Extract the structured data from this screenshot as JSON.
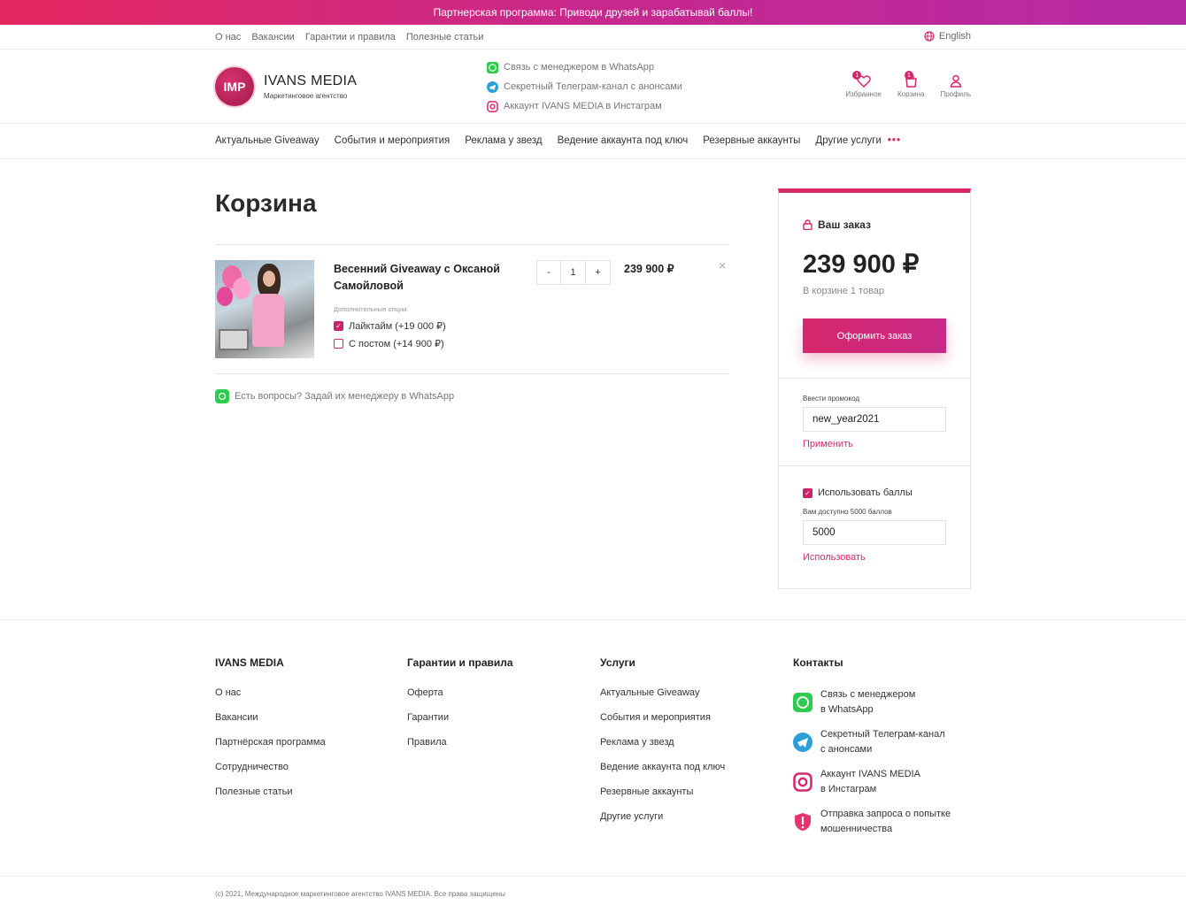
{
  "promo": "Партнерская программа: Приводи друзей и зарабатывай баллы!",
  "topnav": {
    "links": [
      "О нас",
      "Вакансии",
      "Гарантии и правила",
      "Полезные статьи"
    ],
    "lang": "English"
  },
  "brand": {
    "logo": "IMP",
    "name": "IVANS MEDIA",
    "tagline": "Маркетинговое агентство"
  },
  "contacts": [
    "Связь с менеджером в WhatsApp",
    "Секретный Телеграм-канал с анонсами",
    "Аккаунт IVANS MEDIA в Инстаграм"
  ],
  "header_icons": [
    {
      "label": "Избранное",
      "badge": "1",
      "icon": "heart-icon"
    },
    {
      "label": "Корзина",
      "badge": "1",
      "icon": "bag-icon"
    },
    {
      "label": "Профиль",
      "icon": "user-icon"
    }
  ],
  "mainnav": [
    "Актуальные Giveaway",
    "События и мероприятия",
    "Реклама у звезд",
    "Ведение аккаунта под ключ",
    "Резервные аккаунты",
    "Другие услуги"
  ],
  "page_title": "Корзина",
  "cart_item": {
    "name": "Весенний Giveaway с Оксаной Самойловой",
    "options_label": "Дополнительные опции",
    "options": [
      {
        "label": "Лайктайм (+19 000 ₽)",
        "checked": true
      },
      {
        "label": "С постом (+14 900 ₽)",
        "checked": false
      }
    ],
    "qty": "1",
    "minus": "-",
    "plus": "+",
    "price": "239 900 ₽",
    "remove": "×"
  },
  "whatsapp_question": "Есть вопросы? Задай их менеджеру в WhatsApp",
  "order": {
    "title": "Ваш заказ",
    "total": "239 900 ₽",
    "count": "В корзине 1 товар",
    "checkout": "Оформить заказ",
    "promo_label": "Ввести промокод",
    "promo_value": "new_year2021",
    "apply": "Применить",
    "use_points": "Использовать баллы",
    "points_available": "Вам доступно 5000 баллов",
    "points_value": "5000",
    "use": "Использовать"
  },
  "footer": {
    "col1": {
      "title": "IVANS MEDIA",
      "items": [
        "О нас",
        "Вакансии",
        "Партнёрская программа",
        "Сотрудничество",
        "Полезные статьи"
      ]
    },
    "col2": {
      "title": "Гарантии и правила",
      "items": [
        "Оферта",
        "Гарантии",
        "Правила"
      ]
    },
    "col3": {
      "title": "Услуги",
      "items": [
        "Актуальные Giveaway",
        "События и мероприятия",
        "Реклама у звезд",
        "Ведение аккаунта под ключ",
        "Резервные аккаунты",
        "Другие услуги"
      ]
    },
    "col4": {
      "title": "Контакты",
      "items": [
        {
          "l1": "Связь с менеджером",
          "l2": "в WhatsApp",
          "icon": "whatsapp-icon"
        },
        {
          "l1": "Секретный Телеграм-канал",
          "l2": "с анонсами",
          "icon": "telegram-icon"
        },
        {
          "l1": "Аккаунт IVANS MEDIA",
          "l2": "в Инстаграм",
          "icon": "instagram-icon"
        },
        {
          "l1": "Отправка запроса о попытке",
          "l2": "мошенничества",
          "icon": "shield-icon"
        }
      ]
    }
  },
  "copyright": "(c) 2021, Международное маркетинговое агентство IVANS MEDIA. Все права защищены",
  "colors": {
    "accent": "#d6276b",
    "whatsapp": "#2fcb4e",
    "telegram": "#2b9fd9"
  }
}
